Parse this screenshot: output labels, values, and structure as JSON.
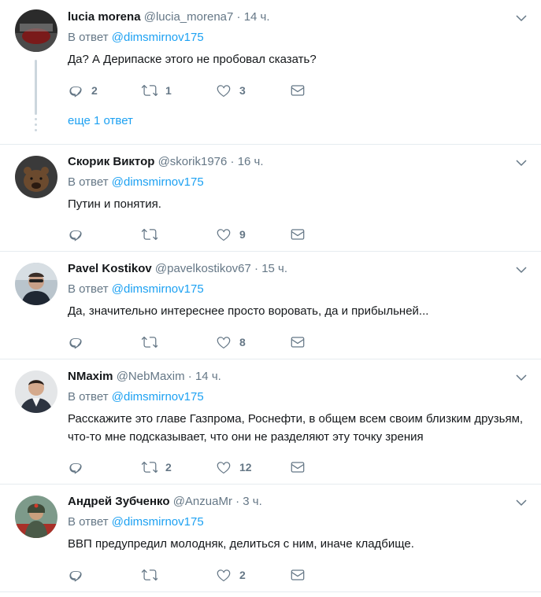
{
  "tweets": [
    {
      "name": "lucia morena",
      "handle": "@lucia_morena7",
      "dot": "·",
      "time": "14 ч.",
      "reply_prefix": "В ответ",
      "reply_to": "@dimsmirnov175",
      "text": "Да? А Дерипаске этого не пробовал сказать?",
      "replies": "2",
      "retweets": "1",
      "likes": "3",
      "more_replies": "еще 1 ответ"
    },
    {
      "name": "Скорик Виктор",
      "handle": "@skorik1976",
      "dot": "·",
      "time": "16 ч.",
      "reply_prefix": "В ответ",
      "reply_to": "@dimsmirnov175",
      "text": "Путин и понятия.",
      "replies": "",
      "retweets": "",
      "likes": "9"
    },
    {
      "name": "Pavel Kostikov",
      "handle": "@pavelkostikov67",
      "dot": "·",
      "time": "15 ч.",
      "reply_prefix": "В ответ",
      "reply_to": "@dimsmirnov175",
      "text": "Да, значительно интереснее просто воровать, да и прибыльней...",
      "replies": "",
      "retweets": "",
      "likes": "8"
    },
    {
      "name": "NMaxim",
      "handle": "@NebMaxim",
      "dot": "·",
      "time": "14 ч.",
      "reply_prefix": "В ответ",
      "reply_to": "@dimsmirnov175",
      "text": "Расскажите это главе Газпрома, Роснефти, в общем всем своим близким друзьям, что-то мне подсказывает, что они не разделяют эту точку зрения",
      "replies": "",
      "retweets": "2",
      "likes": "12"
    },
    {
      "name": "Андрей Зубченко",
      "handle": "@AnzuaMr",
      "dot": "·",
      "time": "3 ч.",
      "reply_prefix": "В ответ",
      "reply_to": "@dimsmirnov175",
      "text": "ВВП предупредил молодняк, делиться с ним, иначе кладбище.",
      "replies": "",
      "retweets": "",
      "likes": "2"
    }
  ],
  "icons": {
    "reply": "reply-icon",
    "retweet": "retweet-icon",
    "like": "heart-icon",
    "message": "envelope-icon",
    "caret": "chevron-down-icon"
  },
  "colors": {
    "accent": "#1da1f2",
    "muted": "#657786",
    "text": "#14171a",
    "divider": "#e6ecf0"
  }
}
